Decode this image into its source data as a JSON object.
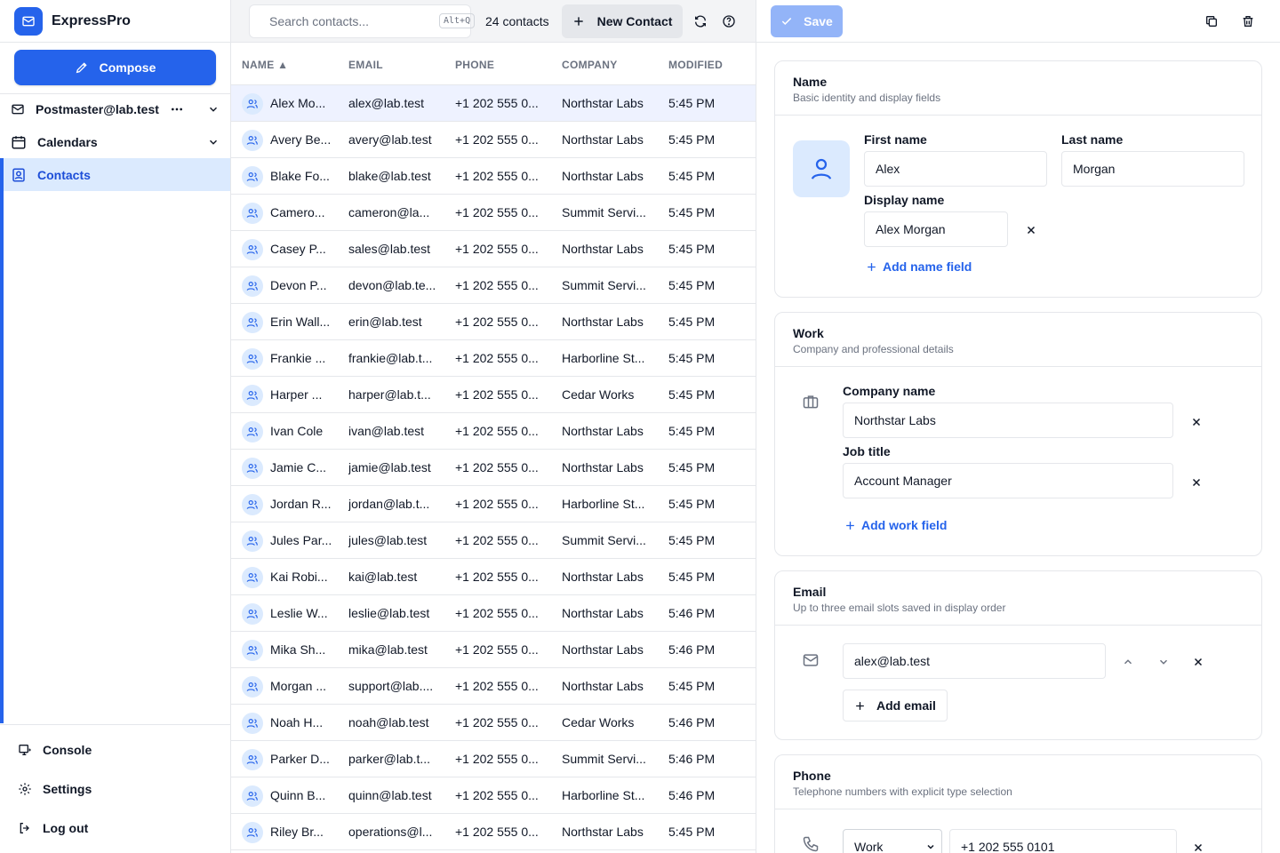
{
  "app": {
    "name": "ExpressPro"
  },
  "sidebar": {
    "compose": "Compose",
    "account": "Postmaster@lab.test",
    "calendars": "Calendars",
    "contacts": "Contacts",
    "console": "Console",
    "settings": "Settings",
    "logout": "Log out"
  },
  "toolbar": {
    "search_placeholder": "Search contacts...",
    "shortcut": "Alt+Q",
    "count": "24 contacts",
    "new_contact": "New Contact"
  },
  "table": {
    "columns": [
      "NAME ▲",
      "EMAIL",
      "PHONE",
      "COMPANY",
      "MODIFIED"
    ],
    "rows": [
      [
        "Alex Mo...",
        "alex@lab.test",
        "+1 202 555 0...",
        "Northstar Labs",
        "5:45 PM"
      ],
      [
        "Avery Be...",
        "avery@lab.test",
        "+1 202 555 0...",
        "Northstar Labs",
        "5:45 PM"
      ],
      [
        "Blake Fo...",
        "blake@lab.test",
        "+1 202 555 0...",
        "Northstar Labs",
        "5:45 PM"
      ],
      [
        "Camero...",
        "cameron@la...",
        "+1 202 555 0...",
        "Summit Servi...",
        "5:45 PM"
      ],
      [
        "Casey P...",
        "sales@lab.test",
        "+1 202 555 0...",
        "Northstar Labs",
        "5:45 PM"
      ],
      [
        "Devon P...",
        "devon@lab.te...",
        "+1 202 555 0...",
        "Summit Servi...",
        "5:45 PM"
      ],
      [
        "Erin Wall...",
        "erin@lab.test",
        "+1 202 555 0...",
        "Northstar Labs",
        "5:45 PM"
      ],
      [
        "Frankie ...",
        "frankie@lab.t...",
        "+1 202 555 0...",
        "Harborline St...",
        "5:45 PM"
      ],
      [
        "Harper ...",
        "harper@lab.t...",
        "+1 202 555 0...",
        "Cedar Works",
        "5:45 PM"
      ],
      [
        "Ivan Cole",
        "ivan@lab.test",
        "+1 202 555 0...",
        "Northstar Labs",
        "5:45 PM"
      ],
      [
        "Jamie C...",
        "jamie@lab.test",
        "+1 202 555 0...",
        "Northstar Labs",
        "5:45 PM"
      ],
      [
        "Jordan R...",
        "jordan@lab.t...",
        "+1 202 555 0...",
        "Harborline St...",
        "5:45 PM"
      ],
      [
        "Jules Par...",
        "jules@lab.test",
        "+1 202 555 0...",
        "Summit Servi...",
        "5:45 PM"
      ],
      [
        "Kai Robi...",
        "kai@lab.test",
        "+1 202 555 0...",
        "Northstar Labs",
        "5:45 PM"
      ],
      [
        "Leslie W...",
        "leslie@lab.test",
        "+1 202 555 0...",
        "Northstar Labs",
        "5:46 PM"
      ],
      [
        "Mika Sh...",
        "mika@lab.test",
        "+1 202 555 0...",
        "Northstar Labs",
        "5:46 PM"
      ],
      [
        "Morgan ...",
        "support@lab....",
        "+1 202 555 0...",
        "Northstar Labs",
        "5:45 PM"
      ],
      [
        "Noah H...",
        "noah@lab.test",
        "+1 202 555 0...",
        "Cedar Works",
        "5:46 PM"
      ],
      [
        "Parker D...",
        "parker@lab.t...",
        "+1 202 555 0...",
        "Summit Servi...",
        "5:46 PM"
      ],
      [
        "Quinn B...",
        "quinn@lab.test",
        "+1 202 555 0...",
        "Harborline St...",
        "5:46 PM"
      ],
      [
        "Riley Br...",
        "operations@l...",
        "+1 202 555 0...",
        "Northstar Labs",
        "5:45 PM"
      ]
    ]
  },
  "detail": {
    "save": "Save",
    "name_card": {
      "title": "Name",
      "subtitle": "Basic identity and display fields",
      "first_label": "First name",
      "first_value": "Alex",
      "last_label": "Last name",
      "last_value": "Morgan",
      "display_label": "Display name",
      "display_value": "Alex Morgan",
      "add": "Add name field"
    },
    "work_card": {
      "title": "Work",
      "subtitle": "Company and professional details",
      "company_label": "Company name",
      "company_value": "Northstar Labs",
      "job_label": "Job title",
      "job_value": "Account Manager",
      "add": "Add work field"
    },
    "email_card": {
      "title": "Email",
      "subtitle": "Up to three email slots saved in display order",
      "value": "alex@lab.test",
      "add": "Add email"
    },
    "phone_card": {
      "title": "Phone",
      "subtitle": "Telephone numbers with explicit type selection",
      "type": "Work",
      "value": "+1 202 555 0101"
    }
  },
  "colors": {
    "accent": "#2563eb",
    "selected_row": "#eef2ff",
    "active_nav": "#dbeafe"
  }
}
